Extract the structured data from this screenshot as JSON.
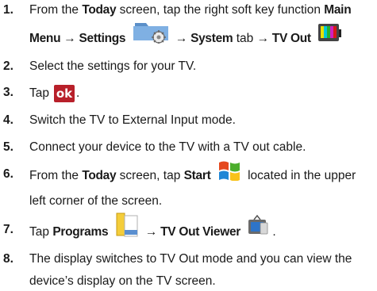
{
  "steps": [
    {
      "num": "1.",
      "l1a": "From the ",
      "l1b": "Today",
      "l1c": " screen, tap the right soft key function ",
      "l1d": "Main",
      "l2a": "Menu → Settings",
      "l2b": "→ System",
      "l2c": " tab ",
      "l2d": "→ TV Out"
    },
    {
      "num": "2.",
      "text": "Select the settings for your TV."
    },
    {
      "num": "3.",
      "text": "Tap",
      "button": "ok",
      "after": "."
    },
    {
      "num": "4.",
      "text": "Switch the TV to External Input mode."
    },
    {
      "num": "5.",
      "text": "Connect your device to the TV with a TV out cable."
    },
    {
      "num": "6.",
      "l1a": "From the ",
      "l1b": "Today",
      "l1c": " screen, tap ",
      "l1d": "Start",
      "l1e": "located in the upper",
      "l2": "left corner of the screen."
    },
    {
      "num": "7.",
      "a": "Tap ",
      "b": "Programs",
      "c": "→ TV Out Viewer",
      "d": "."
    },
    {
      "num": "8.",
      "l1": "The display switches to TV Out mode and you can view the",
      "l2": "device’s display on the TV screen."
    }
  ],
  "icons": {
    "settings": "settings-folder-icon",
    "tv_out": "tv-out-icon",
    "start": "windows-start-icon",
    "programs": "programs-folder-icon",
    "tv_out_viewer": "tv-out-viewer-icon"
  },
  "colors": {
    "ok_button": "#b8202a",
    "folder": "#6d9fd4"
  }
}
